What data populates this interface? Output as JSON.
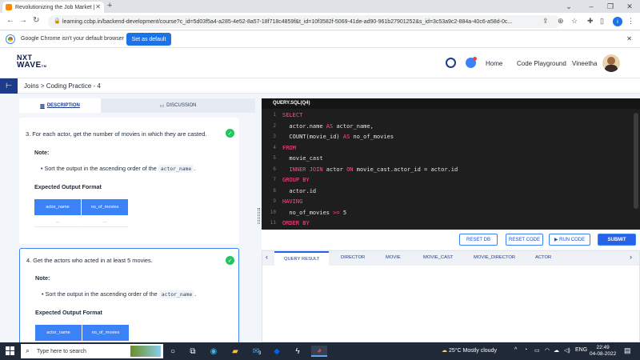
{
  "browser": {
    "tab_title": "Revolutionizing the Job Market |",
    "url": "learning.ccbp.in/backend-development/course?c_id=5d03f5a4-a285-4e52-8a57-18f718c4859f&t_id=10f3582f-5069-41de-ad90-961b27901252&s_id=3c53a9c2-884a-40c6-a58d-0c...",
    "info_message": "Google Chrome isn't your default browser",
    "set_default_label": "Set as default",
    "profile_initial": "i"
  },
  "header": {
    "logo_line1": "NXT",
    "logo_line2": "WAVE",
    "logo_tm": "TM",
    "nav": [
      "Home",
      "Code Playground"
    ],
    "user_name": "Vineetha"
  },
  "breadcrumb": "Joins > Coding Practice - 4",
  "left_tabs": {
    "description": "DESCRIPTION",
    "discussion": "DISCUSSION"
  },
  "questions": [
    {
      "number": "3.",
      "text": "For each actor, get the number of movies in which they are casted.",
      "note_label": "Note:",
      "bullet_text": "Sort the output in the ascending order of the",
      "bullet_code": "actor_name",
      "bullet_end": ".",
      "expected_label": "Expected Output Format",
      "columns": [
        "actor_name",
        "no_of_movies"
      ],
      "cells": [
        "...",
        "..."
      ]
    },
    {
      "number": "4.",
      "text": "Get the actors who acted in at least 5 movies.",
      "note_label": "Note:",
      "bullet_text": "Sort the output in the ascending order of the",
      "bullet_code": "actor_name",
      "bullet_end": ".",
      "expected_label": "Expected Output Format",
      "columns": [
        "actor_name",
        "no_of_movies"
      ]
    }
  ],
  "editor": {
    "file_tab": "QUERY.SQL(Q4)",
    "lines": [
      "1",
      "2",
      "3",
      "4",
      "5",
      "6",
      "7",
      "8",
      "9",
      "10",
      "11"
    ],
    "code": [
      {
        "kw": "SELECT",
        "rest": ""
      },
      {
        "kw": "",
        "rest": "  actor.name ",
        "kw2": "AS",
        "rest2": " actor_name,"
      },
      {
        "kw": "",
        "rest": "  COUNT(movie_id) ",
        "kw2": "AS",
        "rest2": " no_of_movies"
      },
      {
        "kw": "FROM",
        "rest": ""
      },
      {
        "kw": "",
        "rest": "  movie_cast"
      },
      {
        "kw": "  INNER JOIN",
        "rest": " actor ",
        "kw2": "ON",
        "rest2": " movie_cast.actor_id = actor.id"
      },
      {
        "kw": "GROUP BY",
        "rest": ""
      },
      {
        "kw": "",
        "rest": "  actor.id"
      },
      {
        "kw": "HAVING",
        "rest": ""
      },
      {
        "kw": "",
        "rest": "  no_of_movies ",
        "kw2": ">=",
        "rest2": " 5"
      },
      {
        "kw": "ORDER BY",
        "rest": ""
      }
    ]
  },
  "actions": {
    "reset_db": "RESET DB",
    "reset_code": "RESET CODE",
    "run_code": "▶ RUN CODE",
    "submit": "SUBMIT"
  },
  "result_tabs": [
    "QUERY RESULT",
    "DIRECTOR",
    "MOVIE",
    "MOVIE_CAST",
    "MOVIE_DIRECTOR",
    "ACTOR"
  ],
  "taskbar": {
    "search_placeholder": "Type here to search",
    "weather": "25°C  Mostly cloudy",
    "lang": "ENG",
    "time": "22:49",
    "date": "04-08-2022",
    "notif_count": "3"
  }
}
